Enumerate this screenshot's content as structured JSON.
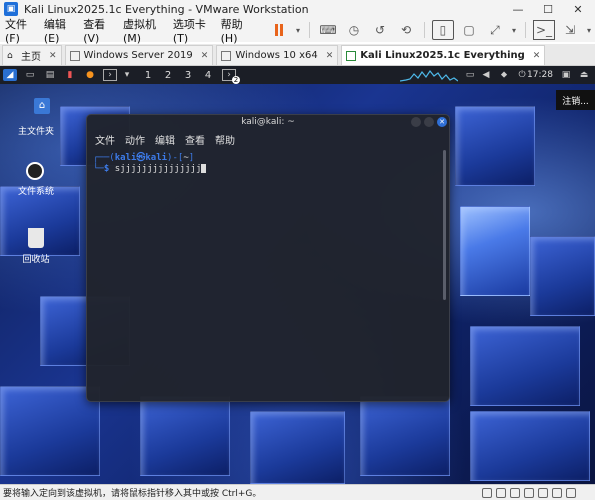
{
  "window": {
    "title": "Kali Linux2025.1c Everything - VMware Workstation",
    "app_icon": "vmware-icon",
    "minimize": "—",
    "maximize": "☐",
    "close": "✕"
  },
  "menubar": {
    "items": [
      "文件(F)",
      "编辑(E)",
      "查看(V)",
      "虚拟机(M)",
      "选项卡(T)",
      "帮助(H)"
    ]
  },
  "tabs": [
    {
      "label": "主页",
      "icon": "home-icon",
      "active": false
    },
    {
      "label": "Windows Server 2019",
      "icon": "vm-icon",
      "active": false
    },
    {
      "label": "Windows 10 x64",
      "icon": "vm-icon",
      "active": false
    },
    {
      "label": "Kali Linux2025.1c Everything",
      "icon": "vm-icon",
      "active": true
    }
  ],
  "tab_close": "✕",
  "kali_panel": {
    "workspaces": [
      "1",
      "2",
      "3",
      "4"
    ],
    "time": "17:28",
    "taskbar_badge": "2"
  },
  "logout_label": "注销...",
  "desktop_icons": [
    {
      "label": "主文件夹",
      "icon": "home-folder-icon"
    },
    {
      "label": "文件系统",
      "icon": "filesystem-icon"
    },
    {
      "label": "回收站",
      "icon": "trash-icon"
    }
  ],
  "terminal": {
    "title": "kali@kali: ~",
    "menu": [
      "文件",
      "动作",
      "编辑",
      "查看",
      "帮助"
    ],
    "prompt_user": "kali㉿kali",
    "prompt_dir": "~",
    "typed": "sjjjjjjjjjjjjjjj"
  },
  "statusbar": {
    "message": "要将输入定向到该虚拟机，请将鼠标指针移入其中或按 Ctrl+G。"
  },
  "colors": {
    "accent": "#3d7be8",
    "pause": "#e8641b",
    "panel_bg": "#1b1e26"
  }
}
